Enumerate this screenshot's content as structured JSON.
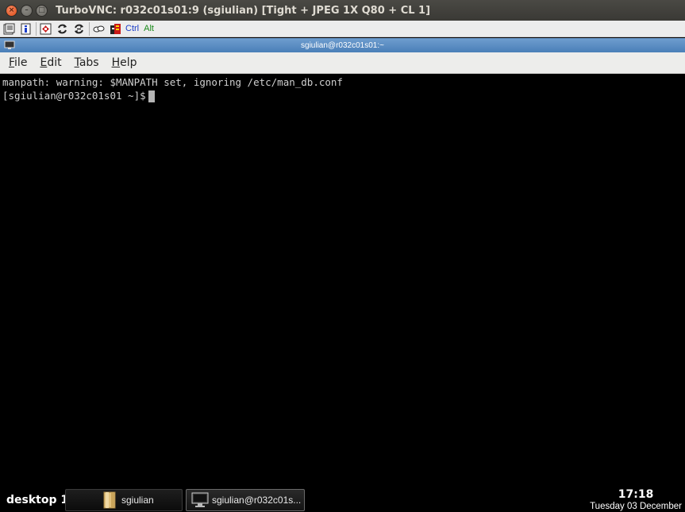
{
  "viewer": {
    "title": "TurboVNC: r032c01s01:9 (sgiulian) [Tight + JPEG 1X Q80 + CL 1]",
    "window_buttons": {
      "close": "×",
      "minimize": "–",
      "maximize": "□"
    },
    "toolbar": {
      "ctrl_label": "Ctrl",
      "alt_label": "Alt",
      "icons": [
        "options-icon",
        "info-icon",
        "fullscreen-icon",
        "refresh-icon",
        "lossless-refresh-icon",
        "clipboard-icon",
        "ctrl-alt-del-icon"
      ],
      "ctrl_color": "#1a3cc8",
      "alt_color": "#1a8a1a"
    }
  },
  "terminal_window": {
    "title": "sgiulian@r032c01s01:~",
    "menu": [
      {
        "mnemonic": "F",
        "rest": "ile"
      },
      {
        "mnemonic": "E",
        "rest": "dit"
      },
      {
        "mnemonic": "T",
        "rest": "abs"
      },
      {
        "mnemonic": "H",
        "rest": "elp"
      }
    ],
    "lines": [
      "manpath: warning: $MANPATH set, ignoring /etc/man_db.conf",
      "[sgiulian@r032c01s01 ~]$"
    ]
  },
  "taskbar": {
    "desktop_label": "desktop 1",
    "tasks": [
      {
        "label": "sgiulian",
        "icon": "folder-icon"
      },
      {
        "label": "sgiulian@r032c01s...",
        "icon": "terminal-icon"
      }
    ],
    "clock": {
      "time": "17:18",
      "date": "Tuesday 03 December"
    }
  },
  "colors": {
    "title_accent": "#df4b16",
    "inner_title": "#5a8cc4"
  }
}
